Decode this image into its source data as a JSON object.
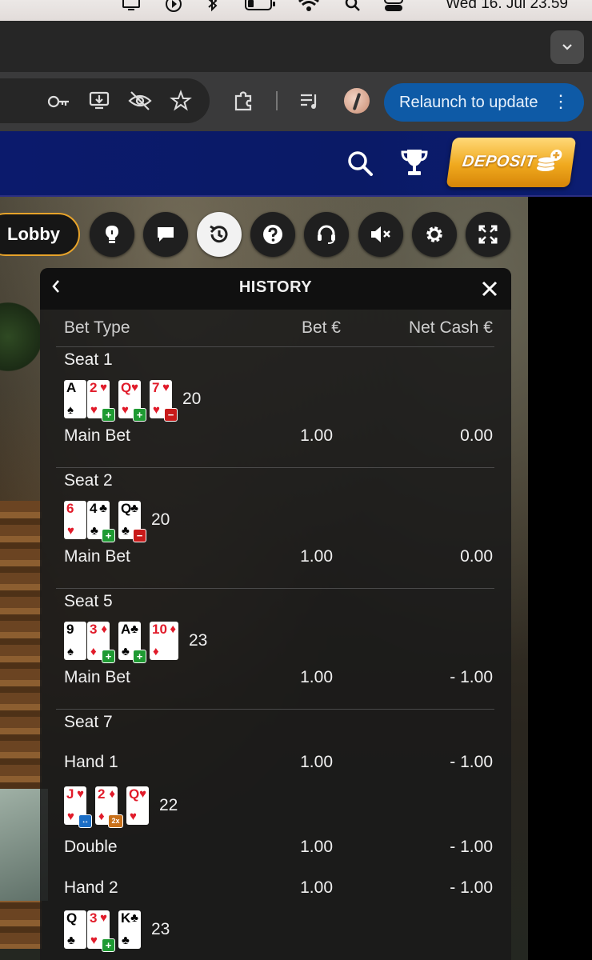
{
  "menubar": {
    "clock": "Wed 16. Jul  23.59"
  },
  "browser": {
    "relaunch_label": "Relaunch to update"
  },
  "site": {
    "deposit_label": "DEPOSIT"
  },
  "controls": {
    "lobby_label": "Lobby"
  },
  "history": {
    "title": "HISTORY",
    "columns": {
      "bet_type": "Bet Type",
      "bet": "Bet €",
      "net": "Net Cash €"
    },
    "seat1": {
      "label": "Seat 1",
      "total": "20",
      "bet_label": "Main Bet",
      "bet": "1.00",
      "net": "0.00"
    },
    "seat2": {
      "label": "Seat 2",
      "total": "20",
      "bet_label": "Main Bet",
      "bet": "1.00",
      "net": "0.00"
    },
    "seat5": {
      "label": "Seat 5",
      "total": "23",
      "bet_label": "Main Bet",
      "bet": "1.00",
      "net": "- 1.00"
    },
    "seat7": {
      "label": "Seat 7",
      "hand1": {
        "label": "Hand 1",
        "bet": "1.00",
        "net": "- 1.00",
        "total": "22"
      },
      "double": {
        "label": "Double",
        "bet": "1.00",
        "net": "- 1.00"
      },
      "hand2": {
        "label": "Hand 2",
        "bet": "1.00",
        "net": "- 1.00",
        "total": "23"
      }
    }
  },
  "cards": {
    "A": "A",
    "2": "2",
    "Q": "Q",
    "7": "7",
    "6": "6",
    "4": "4",
    "9": "9",
    "3": "3",
    "10": "10",
    "J": "J",
    "K": "K",
    "heart": "♥",
    "club": "♣",
    "diamond": "♦",
    "spade": "♠",
    "plus": "+",
    "minus": "−",
    "double": "2x"
  },
  "icons": {
    "display": "display-icon",
    "play": "play-circle-icon",
    "bluetooth": "bluetooth-icon",
    "battery": "battery-icon",
    "wifi": "wifi-icon",
    "search": "search-icon",
    "toggle": "control-center-icon",
    "key": "key-icon",
    "install": "install-icon",
    "eye_off": "eye-off-icon",
    "star": "star-icon",
    "extensions": "puzzle-icon",
    "media": "media-control-icon",
    "menu_dots": "menu-dots-icon",
    "trophy": "trophy-icon",
    "coins": "coins-plus-icon"
  },
  "colors": {
    "relaunch_bg": "#0e5aa6",
    "header_bg": "#0b1a6c",
    "deposit": "#f0a91e",
    "lobby_border": "#e7a32a",
    "win_tag": "#1e9a32",
    "loss_tag": "#c81a1a"
  }
}
